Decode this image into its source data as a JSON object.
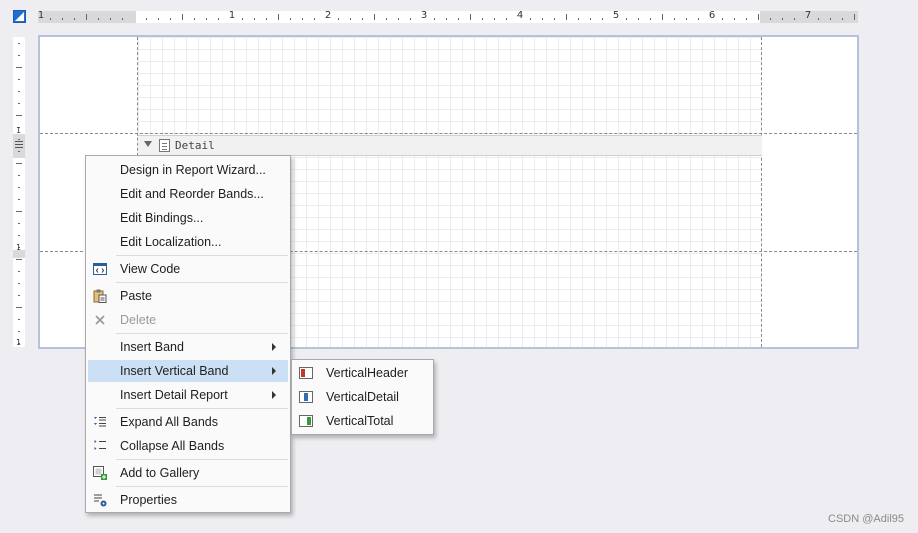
{
  "ruler": {
    "horizontal_numbers": [
      "1",
      "1",
      "2",
      "3",
      "4",
      "5",
      "6",
      "7"
    ],
    "vertical_numbers": [
      "1",
      "1",
      "1"
    ]
  },
  "band": {
    "label": "Detail"
  },
  "context_menu": {
    "items": [
      {
        "label": "Design in Report Wizard...",
        "icon": "",
        "enabled": true
      },
      {
        "label": "Edit and Reorder Bands...",
        "icon": "",
        "enabled": true
      },
      {
        "label": "Edit Bindings...",
        "icon": "",
        "enabled": true
      },
      {
        "label": "Edit Localization...",
        "icon": "",
        "enabled": true
      },
      {
        "label": "View Code",
        "icon": "view-code-icon",
        "enabled": true
      },
      {
        "label": "Paste",
        "icon": "paste-icon",
        "enabled": true
      },
      {
        "label": "Delete",
        "icon": "delete-icon",
        "enabled": false
      },
      {
        "label": "Insert Band",
        "icon": "",
        "enabled": true,
        "submenu": true
      },
      {
        "label": "Insert Vertical Band",
        "icon": "",
        "enabled": true,
        "submenu": true,
        "highlighted": true
      },
      {
        "label": "Insert Detail Report",
        "icon": "",
        "enabled": true,
        "submenu": true
      },
      {
        "label": "Expand All Bands",
        "icon": "expand-all-icon",
        "enabled": true
      },
      {
        "label": "Collapse All Bands",
        "icon": "collapse-all-icon",
        "enabled": true
      },
      {
        "label": "Add to Gallery",
        "icon": "add-to-gallery-icon",
        "enabled": true
      },
      {
        "label": "Properties",
        "icon": "properties-icon",
        "enabled": true
      }
    ]
  },
  "submenu": {
    "items": [
      {
        "label": "VerticalHeader",
        "icon": "vertical-header-icon",
        "color": "#c0392b"
      },
      {
        "label": "VerticalDetail",
        "icon": "vertical-detail-icon",
        "color": "#2f6db5"
      },
      {
        "label": "VerticalTotal",
        "icon": "vertical-total-icon",
        "color": "#3a9a3a"
      }
    ]
  },
  "colors": {
    "highlight": "#cce0f5",
    "surface_border": "#b4c4d8",
    "accent": "#1f6fd1"
  },
  "watermark": "CSDN @Adil95"
}
